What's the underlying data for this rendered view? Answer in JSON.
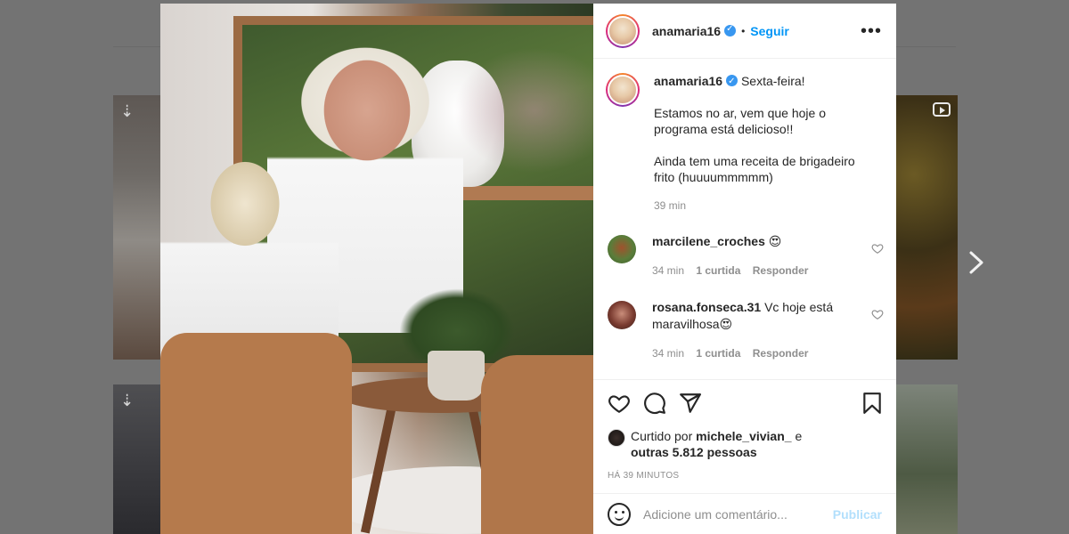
{
  "background": {
    "next_icon": "chevron-right-icon",
    "reel_icon": "reel-icon",
    "download_icon": "arrow-down-icon"
  },
  "post": {
    "author": "anamaria16",
    "follow_label": "Seguir",
    "more_icon": "ellipsis-icon",
    "caption": {
      "first_line": "Sexta-feira!",
      "paragraph1": "Estamos no ar, vem que hoje o programa está delicioso!!",
      "paragraph2": "Ainda tem uma receita de brigadeiro frito (huuuummmmm)",
      "time": "39 min"
    },
    "comments": [
      {
        "user": "marcilene_croches",
        "text": "😍",
        "time": "34 min",
        "likes": "1 curtida",
        "reply_label": "Responder"
      },
      {
        "user": "rosana.fonseca.31",
        "text": "Vc hoje está maravilhosa😍",
        "time": "34 min",
        "likes": "1 curtida",
        "reply_label": "Responder"
      }
    ],
    "liked_by": {
      "prefix": "Curtido por",
      "user": "michele_vivian_",
      "connector": "e",
      "others": "outras 5.812 pessoas"
    },
    "posted_ago": "HÁ 39 MINUTOS",
    "comment_placeholder": "Adicione um comentário...",
    "publish_label": "Publicar"
  },
  "colors": {
    "link_blue": "#0095f6",
    "publish_disabled": "#b2dffc",
    "overlay": "#737373"
  }
}
